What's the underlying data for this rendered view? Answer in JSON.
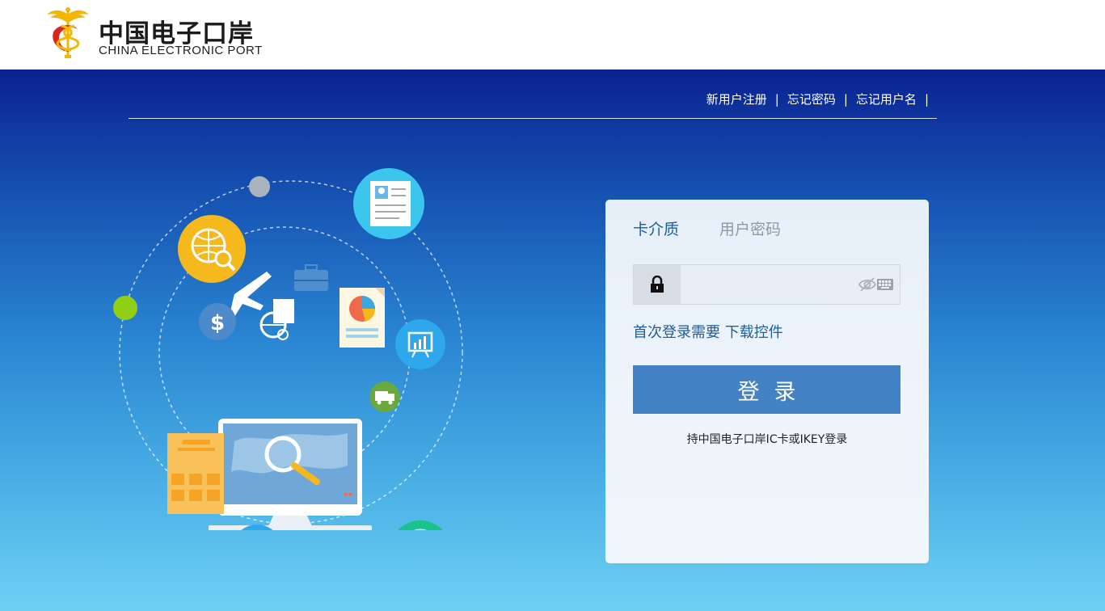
{
  "header": {
    "logo_cn": "中国电子口岸",
    "logo_en": "CHINA ELECTRONIC PORT"
  },
  "top_links": {
    "register": "新用户注册",
    "forgot_password": "忘记密码",
    "forgot_username": "忘记用户名",
    "separator": "|"
  },
  "login": {
    "tabs": [
      "卡介质",
      "用户密码"
    ],
    "active_tab": 0,
    "password_placeholder": "",
    "plugin_text": "首次登录需要",
    "plugin_link": "下载控件",
    "submit_label": "登录",
    "hint": "持中国电子口岸IC卡或IKEY登录"
  },
  "colors": {
    "brand_blue": "#4482c6",
    "link_blue": "#1e5e9a",
    "gradient_top": "#0a2291",
    "gradient_bottom": "#6dd0f3"
  },
  "icons": {
    "lock": "lock-icon",
    "eye": "eye-hidden-icon",
    "keyboard": "keyboard-icon"
  }
}
